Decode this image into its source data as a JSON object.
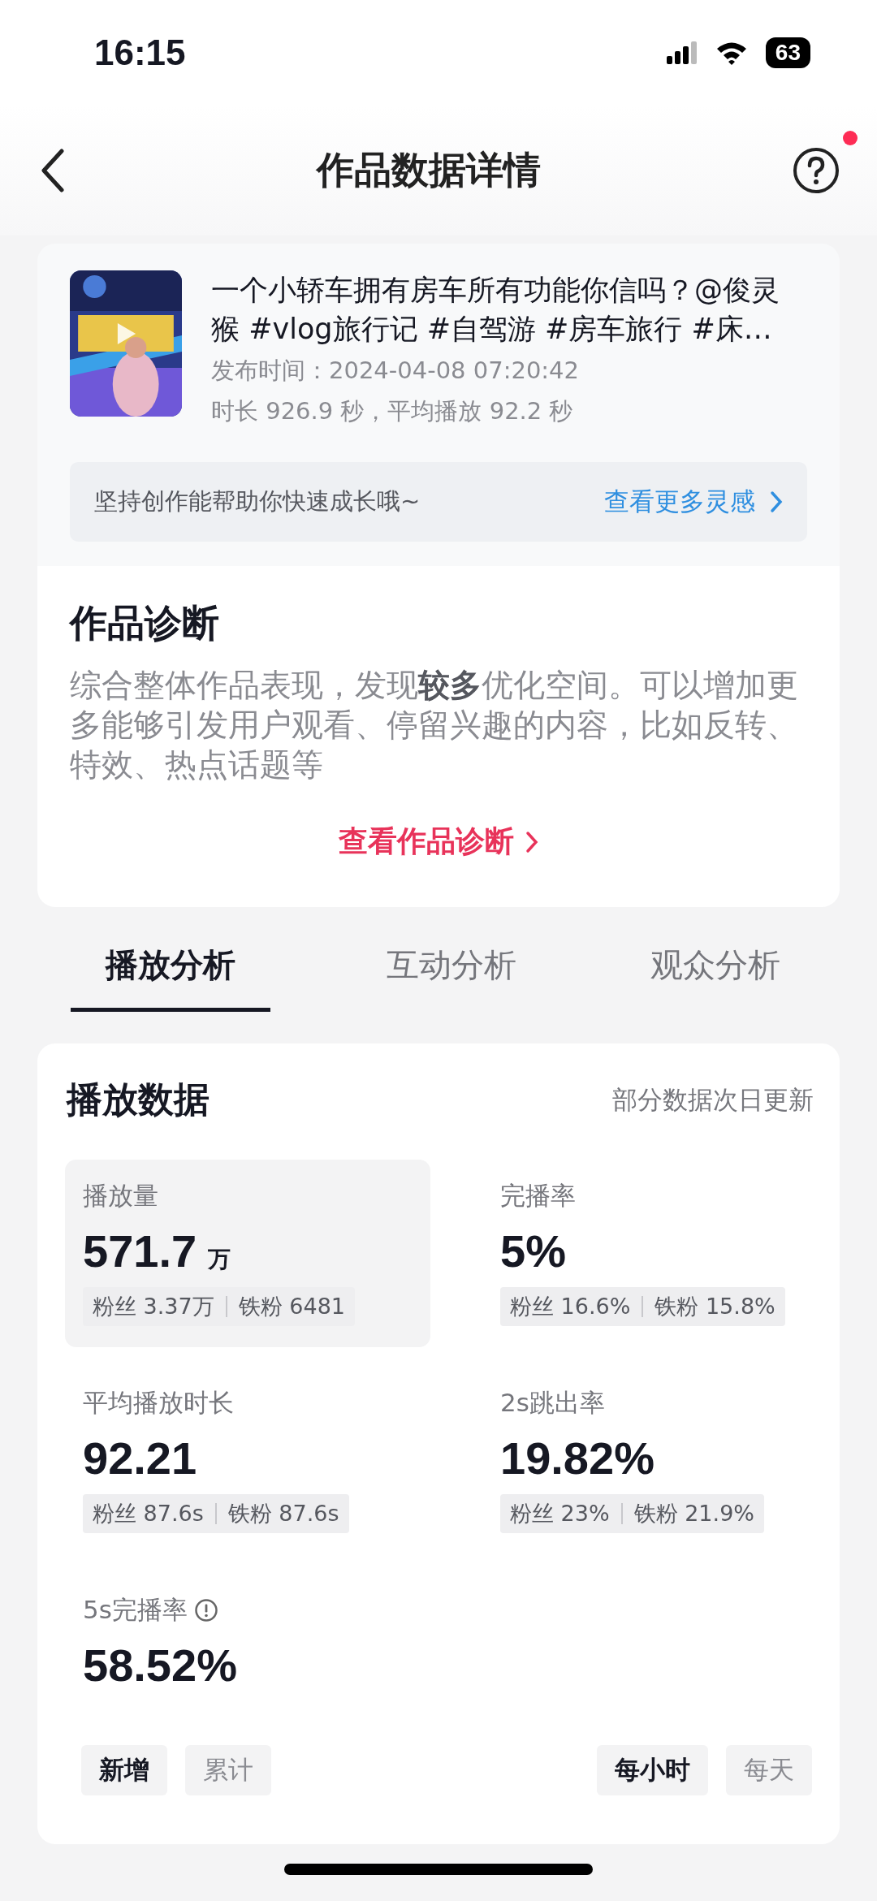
{
  "status_bar": {
    "time": "16:15",
    "battery": "63"
  },
  "nav": {
    "title": "作品数据详情",
    "help_badge": true
  },
  "video": {
    "title": "一个小轿车拥有房车所有功能你信吗？@俊灵猴 #vlog旅行记 #自驾游 #房车旅行 #床…",
    "published": "发布时间：2024-04-08 07:20:42",
    "duration": "时长 926.9 秒，平均播放 92.2 秒"
  },
  "banner": {
    "text": "坚持创作能帮助你快速成长哦~",
    "link": "查看更多灵感"
  },
  "diagnosis": {
    "title": "作品诊断",
    "text": "综合整体作品表现，发现**较多**优化空间。可以增加更多能够引发用户观看、停留兴趣的内容，比如反转、特效、热点话题等",
    "link": "查看作品诊断"
  },
  "tabs": [
    {
      "label": "播放分析",
      "selected": true
    },
    {
      "label": "互动分析",
      "selected": false
    },
    {
      "label": "观众分析",
      "selected": false
    }
  ],
  "playback": {
    "title": "播放数据",
    "note": "部分数据次日更新",
    "metrics": [
      {
        "label": "播放量",
        "value": "571.7",
        "unit": "万",
        "selected": true,
        "chips": [
          "粉丝 3.37万",
          "铁粉 6481"
        ]
      },
      {
        "label": "完播率",
        "value": "5%",
        "selected": false,
        "chips": [
          "粉丝 16.6%",
          "铁粉 15.8%"
        ]
      },
      {
        "label": "平均播放时长",
        "value": "92.21",
        "selected": false,
        "chips": [
          "粉丝 87.6s",
          "铁粉 87.6s"
        ]
      },
      {
        "label": "2s跳出率",
        "value": "19.82%",
        "selected": false,
        "chips": [
          "粉丝 23%",
          "铁粉 21.9%"
        ]
      },
      {
        "label": "5s完播率",
        "value": "58.52%",
        "selected": false,
        "info": true
      }
    ],
    "mode_toggle": [
      {
        "label": "新增",
        "selected": true
      },
      {
        "label": "累计",
        "selected": false
      }
    ],
    "period_toggle": [
      {
        "label": "每小时",
        "selected": true
      },
      {
        "label": "每天",
        "selected": false
      }
    ]
  }
}
